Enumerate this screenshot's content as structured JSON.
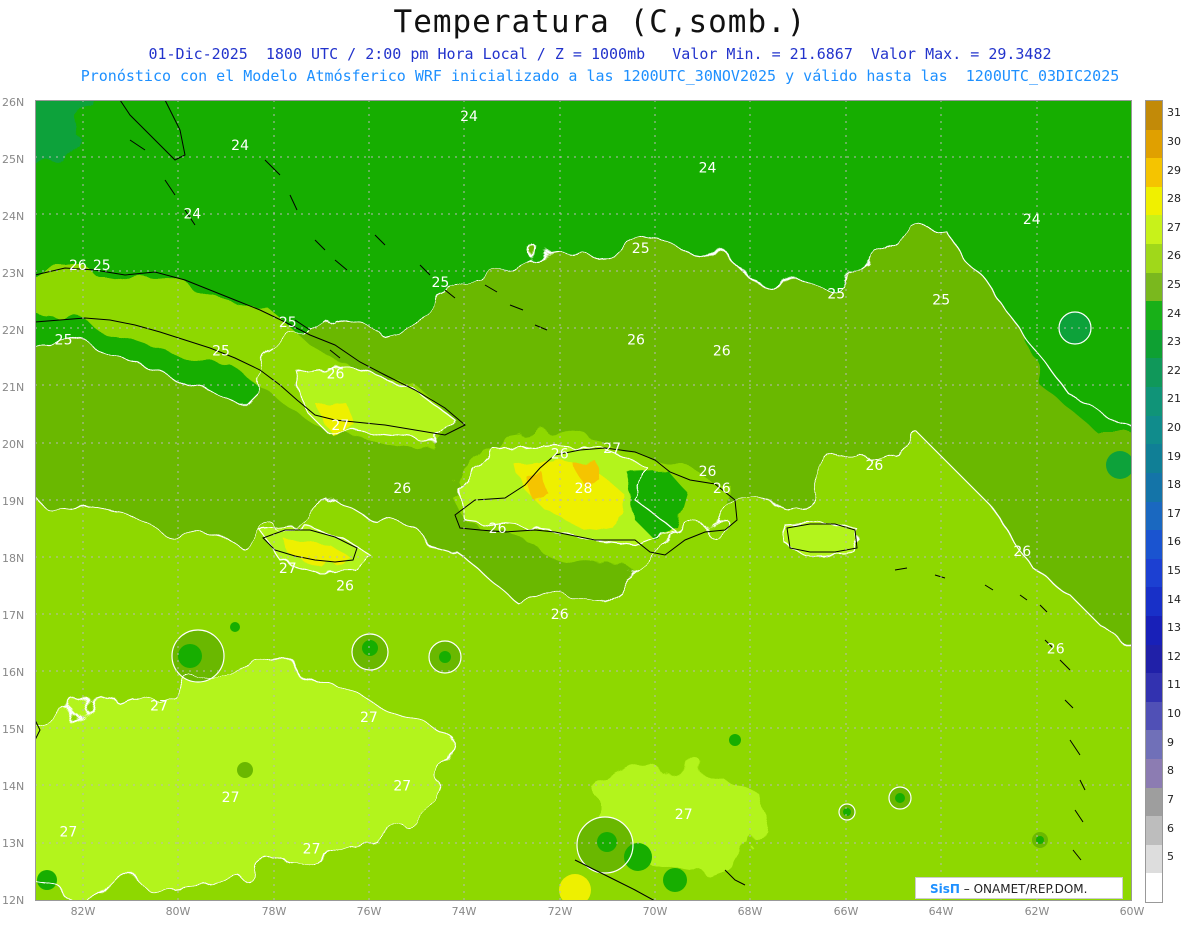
{
  "header": {
    "title": "Temperatura (C,somb.)",
    "subtitle1": "01-Dic-2025  1800 UTC / 2:00 pm Hora Local / Z = 1000mb   Valor Min. = 21.6867  Valor Max. = 29.3482",
    "subtitle2": "Pronóstico con el Modelo Atmósferico WRF inicializado a las 1200UTC_30NOV2025 y válido hasta las  1200UTC_03DIC2025"
  },
  "map": {
    "lon_range": [
      -83,
      -60
    ],
    "lat_range": [
      12,
      26
    ],
    "lat_ticks": [
      "26N",
      "25N",
      "24N",
      "23N",
      "22N",
      "21N",
      "20N",
      "19N",
      "18N",
      "17N",
      "16N",
      "15N",
      "14N",
      "13N",
      "12N"
    ],
    "lon_ticks": [
      "82W",
      "80W",
      "78W",
      "76W",
      "74W",
      "72W",
      "70W",
      "68W",
      "66W",
      "64W",
      "62W",
      "60W"
    ],
    "contour_labels": [
      {
        "text": "24",
        "lon": -73.9,
        "lat": 25.7
      },
      {
        "text": "24",
        "lon": -78.7,
        "lat": 25.2
      },
      {
        "text": "24",
        "lon": -79.7,
        "lat": 24.0
      },
      {
        "text": "24",
        "lon": -68.9,
        "lat": 24.8
      },
      {
        "text": "24",
        "lon": -62.1,
        "lat": 23.9
      },
      {
        "text": "26",
        "lon": -82.1,
        "lat": 23.1
      },
      {
        "text": "25",
        "lon": -81.6,
        "lat": 23.1
      },
      {
        "text": "25",
        "lon": -74.5,
        "lat": 22.8
      },
      {
        "text": "25",
        "lon": -70.3,
        "lat": 23.4
      },
      {
        "text": "25",
        "lon": -66.2,
        "lat": 22.6
      },
      {
        "text": "25",
        "lon": -64.0,
        "lat": 22.5
      },
      {
        "text": "25",
        "lon": -82.4,
        "lat": 21.8
      },
      {
        "text": "25",
        "lon": -77.7,
        "lat": 22.1
      },
      {
        "text": "25",
        "lon": -79.1,
        "lat": 21.6
      },
      {
        "text": "26",
        "lon": -76.7,
        "lat": 21.2
      },
      {
        "text": "26",
        "lon": -70.4,
        "lat": 21.8
      },
      {
        "text": "26",
        "lon": -68.6,
        "lat": 21.6
      },
      {
        "text": "27",
        "lon": -76.6,
        "lat": 20.3
      },
      {
        "text": "26",
        "lon": -72.0,
        "lat": 19.8
      },
      {
        "text": "27",
        "lon": -70.9,
        "lat": 19.9
      },
      {
        "text": "26",
        "lon": -75.3,
        "lat": 19.2
      },
      {
        "text": "26",
        "lon": -68.9,
        "lat": 19.5
      },
      {
        "text": "26",
        "lon": -68.6,
        "lat": 19.2
      },
      {
        "text": "26",
        "lon": -65.4,
        "lat": 19.6
      },
      {
        "text": "28",
        "lon": -71.5,
        "lat": 19.2
      },
      {
        "text": "26",
        "lon": -73.3,
        "lat": 18.5
      },
      {
        "text": "26",
        "lon": -62.3,
        "lat": 18.1
      },
      {
        "text": "27",
        "lon": -77.7,
        "lat": 17.8
      },
      {
        "text": "26",
        "lon": -76.5,
        "lat": 17.5
      },
      {
        "text": "26",
        "lon": -72.0,
        "lat": 17.0
      },
      {
        "text": "26",
        "lon": -61.6,
        "lat": 16.4
      },
      {
        "text": "27",
        "lon": -80.4,
        "lat": 15.4
      },
      {
        "text": "27",
        "lon": -76.0,
        "lat": 15.2
      },
      {
        "text": "27",
        "lon": -75.3,
        "lat": 14.0
      },
      {
        "text": "27",
        "lon": -78.9,
        "lat": 13.8
      },
      {
        "text": "27",
        "lon": -69.4,
        "lat": 13.5
      },
      {
        "text": "27",
        "lon": -82.3,
        "lat": 13.2
      },
      {
        "text": "27",
        "lon": -77.2,
        "lat": 12.9
      }
    ]
  },
  "colorbar": {
    "labels": [
      "31",
      "30",
      "29",
      "28",
      "27",
      "26",
      "25",
      "24",
      "23",
      "22",
      "21",
      "20",
      "19",
      "18",
      "17",
      "16",
      "15",
      "14",
      "13",
      "12",
      "11",
      "10",
      "9",
      "8",
      "7",
      "6",
      "5"
    ],
    "colors": {
      "31": "#c28a08",
      "30": "#e0a000",
      "29": "#f5c400",
      "28": "#f0f000",
      "27": "#c8f21a",
      "26": "#a0d81a",
      "25": "#7ab81e",
      "24": "#18b018",
      "23": "#0ea032",
      "22": "#10985a",
      "21": "#109478",
      "20": "#108c8c",
      "19": "#107f96",
      "18": "#1474a8",
      "17": "#1a68c0",
      "16": "#1a54d0",
      "15": "#1c40d2",
      "14": "#1830c8",
      "13": "#1820b8",
      "12": "#2020a8",
      "11": "#3232b0",
      "10": "#5050b6",
      "9": "#7070b8",
      "8": "#8c7cb2",
      "7": "#9e9e9e",
      "6": "#bdbdbd",
      "5": "#dddddd",
      "below": "#ffffff"
    }
  },
  "credit": {
    "brand": "SisΠ",
    "text": " – ONAMET/REP.DOM."
  }
}
